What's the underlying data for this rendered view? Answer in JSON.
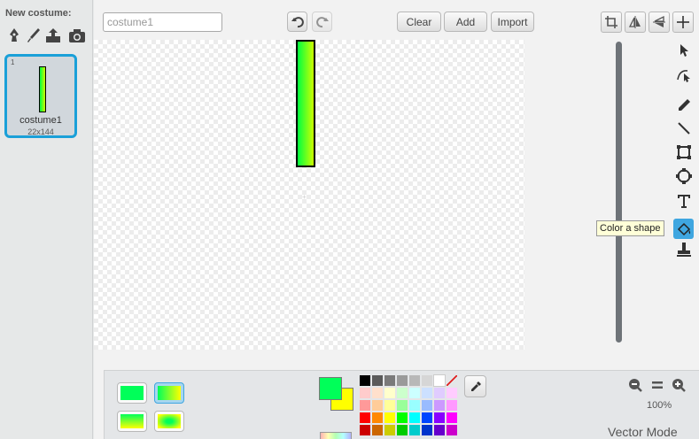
{
  "costumes_pane": {
    "new_costume_label": "New costume:",
    "icons": [
      "paint-icon",
      "brush-icon",
      "upload-icon",
      "camera-icon"
    ],
    "costume": {
      "number": "1",
      "name": "costume1",
      "size": "22x144"
    }
  },
  "editor": {
    "name_input": {
      "value": "costume1"
    },
    "toolbar": {
      "clear": "Clear",
      "add": "Add",
      "import": "Import"
    },
    "tooltip": "Color a shape",
    "zoom_level": "100%",
    "mode": "Vector Mode"
  },
  "colors": {
    "primary": "#00ff59",
    "secondary": "#ffff00",
    "accent": "#1aa0d8",
    "palette": [
      "#000000",
      "#5a5a5a",
      "#7a7a7a",
      "#9a9a9a",
      "#b8b8b8",
      "#d6d6d6",
      "#ffffff",
      "none",
      "#ffcccc",
      "#ffe0cc",
      "#ffffcc",
      "#ccffcc",
      "#ccffff",
      "#cce0ff",
      "#e0ccff",
      "#ffccff",
      "#ff9999",
      "#ffcc99",
      "#ffff99",
      "#99ff99",
      "#99ffff",
      "#99bbff",
      "#cc99ff",
      "#ff99ff",
      "#ff0000",
      "#ff8800",
      "#ffff00",
      "#00ff00",
      "#00ffff",
      "#0044ff",
      "#8800ff",
      "#ff00ff",
      "#cc0000",
      "#cc6600",
      "#cccc00",
      "#00cc00",
      "#00cccc",
      "#0033cc",
      "#6600cc",
      "#cc00cc"
    ]
  }
}
